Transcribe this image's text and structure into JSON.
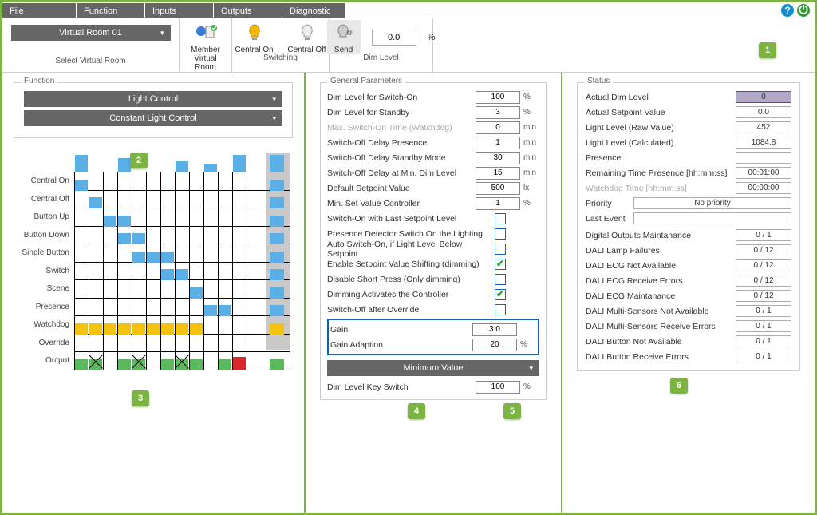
{
  "menu": {
    "file": "File",
    "function": "Function",
    "inputs": "Inputs",
    "outputs": "Outputs",
    "diagnostic": "Diagnostic"
  },
  "toolbar": {
    "virtual_room_selected": "Virtual Room 01",
    "select_vr_caption": "Select Virtual Room",
    "member_vr": "Member\nVirtual Room",
    "central_on": "Central On",
    "central_off": "Central Off",
    "switching_caption": "Switching",
    "send": "Send",
    "dim_level_caption": "Dim Level",
    "dim_level_value": "0.0",
    "dim_level_unit": "%"
  },
  "function_panel": {
    "title": "Function",
    "dd1": "Light Control",
    "dd2": "Constant Light Control"
  },
  "chart_rows": [
    "Central On",
    "Central Off",
    "Button Up",
    "Button Down",
    "Single Button",
    "Switch",
    "Scene",
    "Presence",
    "Watchdog",
    "Override",
    "Output"
  ],
  "chart_data": {
    "type": "table",
    "note": "State-transition matrix depicted as colored blocks; columns are 12 states (0-11) plus summary column 12. Colors: blue=active trigger, yellow=presence hold, green=output on, red=override output, gray=summary band. 'x' marks disabled output cells.",
    "rows": {
      "Central On": {
        "blue_cols": [
          0
        ],
        "summary": "blue"
      },
      "Central Off": {
        "blue_cols": [
          1
        ],
        "summary": "blue"
      },
      "Button Up": {
        "blue_cols": [
          2,
          3
        ],
        "summary": "blue"
      },
      "Button Down": {
        "blue_cols": [
          3,
          4
        ],
        "summary": "blue"
      },
      "Single Button": {
        "blue_cols": [
          4,
          5,
          6
        ],
        "summary": "blue"
      },
      "Switch": {
        "blue_cols": [
          6,
          7
        ],
        "summary": "blue"
      },
      "Scene": {
        "blue_cols": [
          8
        ],
        "summary": "blue"
      },
      "Presence": {
        "blue_cols": [
          9,
          10
        ],
        "summary": "blue"
      },
      "Watchdog": {
        "yellow_cols": [
          0,
          1,
          2,
          3,
          4,
          5,
          6,
          7,
          8
        ],
        "summary": "yellow"
      },
      "Override": {
        "": ""
      },
      "Output": {
        "green_cols": [
          0,
          3,
          6,
          8,
          10
        ],
        "green_x_cols": [
          1,
          4,
          7
        ],
        "red_cols": [
          11
        ],
        "summary": "green"
      }
    }
  },
  "general_params": {
    "title": "General Parameters",
    "rows": [
      {
        "label": "Dim Level for Switch-On",
        "value": "100",
        "unit": "%"
      },
      {
        "label": "Dim Level for Standby",
        "value": "3",
        "unit": "%"
      },
      {
        "label": "Max. Switch-On Time (Watchdog)",
        "value": "0",
        "unit": "min",
        "disabled": true
      },
      {
        "label": "Switch-Off Delay Presence",
        "value": "1",
        "unit": "min"
      },
      {
        "label": "Switch-Off Delay Standby Mode",
        "value": "30",
        "unit": "min"
      },
      {
        "label": "Switch-Off Delay at Min. Dim Level",
        "value": "15",
        "unit": "min"
      },
      {
        "label": "Default Setpoint Value",
        "value": "500",
        "unit": "lx"
      },
      {
        "label": "Min. Set Value Controller",
        "value": "1",
        "unit": "%"
      }
    ],
    "checks": [
      {
        "label": "Switch-On with Last Setpoint Level",
        "on": false
      },
      {
        "label": "Presence Detector Switch On the Lighting",
        "on": false
      },
      {
        "label": "Auto Switch-On, if Light Level Below Setpoint",
        "on": false
      },
      {
        "label": "Enable Setpoint Value Shifting (dimming)",
        "on": true
      },
      {
        "label": "Disable Short Press (Only dimming)",
        "on": false
      },
      {
        "label": "Dimming Activates the Controller",
        "on": true
      },
      {
        "label": "Switch-Off after Override",
        "on": false
      }
    ],
    "gain_label": "Gain",
    "gain_value": "3.0",
    "gain_adapt_label": "Gain Adaption",
    "gain_adapt_value": "20",
    "gain_adapt_unit": "%",
    "minimum_value": "Minimum Value",
    "dim_key_label": "Dim Level Key Switch",
    "dim_key_value": "100",
    "dim_key_unit": "%"
  },
  "status": {
    "title": "Status",
    "rows": [
      {
        "label": "Actual Dim Level",
        "value": "0",
        "highlight": true
      },
      {
        "label": "Actual Setpoint Value",
        "value": "0.0"
      },
      {
        "label": "Light Level (Raw Value)",
        "value": "452"
      },
      {
        "label": "Light Level (Calculated)",
        "value": "1084.8"
      },
      {
        "label": "Presence",
        "value": ""
      },
      {
        "label": "Remaining Time Presence [hh:mm:ss]",
        "value": "00:01:00"
      },
      {
        "label": "Watchdog Time [hh:mm:ss]",
        "value": "00:00:00",
        "disabled": true
      }
    ],
    "priority_label": "Priority",
    "priority_value": "No priority",
    "lastevent_label": "Last Event",
    "lastevent_value": "",
    "diag": [
      {
        "label": "Digital Outputs Maintanance",
        "value": "0 / 1"
      },
      {
        "label": "DALI Lamp Failures",
        "value": "0 / 12"
      },
      {
        "label": "DALI ECG Not Available",
        "value": "0 / 12"
      },
      {
        "label": "DALI ECG Receive Errors",
        "value": "0 / 12"
      },
      {
        "label": "DALI ECG Maintanance",
        "value": "0 / 12"
      },
      {
        "label": "DALI Multi-Sensors Not Available",
        "value": "0 / 1"
      },
      {
        "label": "DALI Multi-Sensors Receive Errors",
        "value": "0 / 1"
      },
      {
        "label": "DALI Button Not Available",
        "value": "0 / 1"
      },
      {
        "label": "DALI Button Receive Errors",
        "value": "0 / 1"
      }
    ]
  },
  "callouts": {
    "c1": "1",
    "c2": "2",
    "c3": "3",
    "c4": "4",
    "c5": "5",
    "c6": "6"
  }
}
